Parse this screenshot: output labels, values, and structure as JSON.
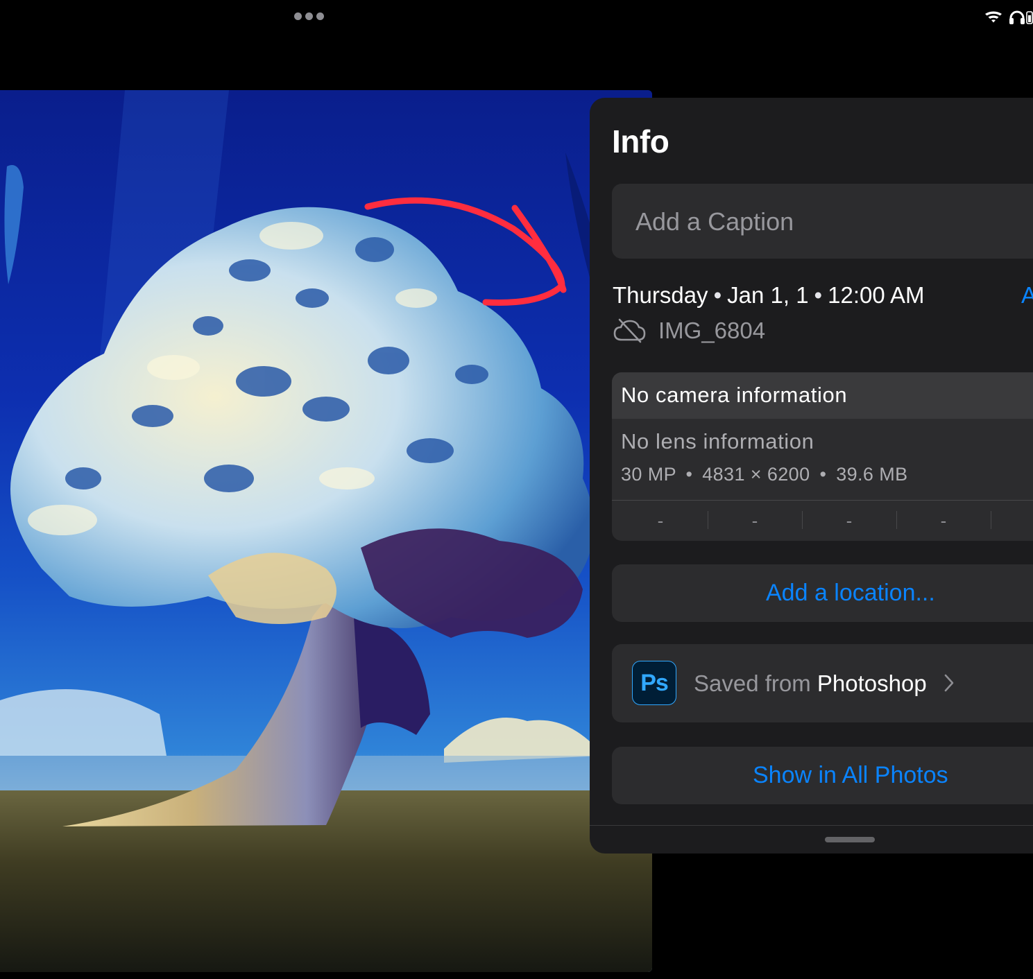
{
  "panel": {
    "title": "Info",
    "caption_placeholder": "Add a Caption",
    "date": {
      "weekday": "Thursday",
      "date": "Jan 1, 1",
      "time": "12:00 AM",
      "separator": "•",
      "adjust_label": "A"
    },
    "file_name": "IMG_6804",
    "metadata": {
      "camera": "No camera information",
      "lens": "No lens information",
      "resolution": "30 MP",
      "dimensions": "4831 × 6200",
      "file_size": "39.6 MB",
      "separator": "•",
      "exif_values": [
        "-",
        "-",
        "-",
        "-"
      ]
    },
    "location_link": "Add a location...",
    "app": {
      "icon_text": "Ps",
      "saved_from": "Saved from",
      "app_name": "Photoshop"
    },
    "show_all_link": "Show in All Photos"
  },
  "colors": {
    "accent": "#0a84ff",
    "panel_bg": "#1c1c1e",
    "card_bg": "#2c2c2e",
    "annotation_stroke": "#ff2d3f"
  },
  "icons": {
    "status_dots": "more-dots-icon",
    "wifi": "wifi-icon",
    "headphones": "headphones-icon",
    "battery": "battery-icon",
    "cloud": "cloud-off-icon",
    "chevron": "chevron-right-icon"
  }
}
